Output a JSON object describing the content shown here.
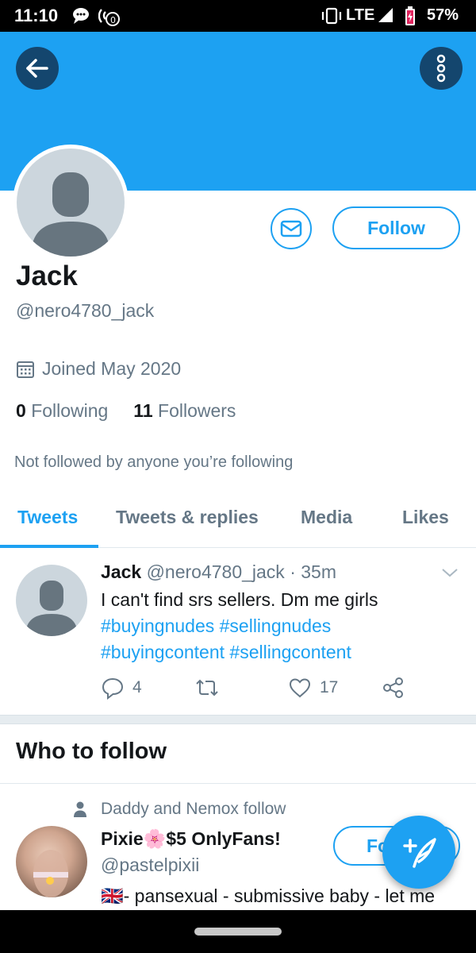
{
  "status_bar": {
    "time": "11:10",
    "network": "LTE",
    "battery": "57%"
  },
  "colors": {
    "accent": "#1da1f2",
    "banner": "#1da1f2",
    "muted_text": "#657786"
  },
  "header": {
    "back_icon": "arrow-left-icon",
    "more_icon": "more-vertical-icon"
  },
  "profile": {
    "name": "Jack",
    "handle": "@nero4780_jack",
    "joined": "Joined May 2020",
    "following_count": "0",
    "following_label": "Following",
    "followers_count": "11",
    "followers_label": "Followers",
    "not_followed": "Not followed by anyone you’re following",
    "follow_label": "Follow",
    "message_icon": "mail-icon"
  },
  "tabs": [
    {
      "label": "Tweets",
      "active": true
    },
    {
      "label": "Tweets & replies",
      "active": false
    },
    {
      "label": "Media",
      "active": false
    },
    {
      "label": "Likes",
      "active": false
    }
  ],
  "tweet": {
    "author": "Jack",
    "handle": "@nero4780_jack",
    "time": "35m",
    "text": "I can't find srs sellers. Dm me girls",
    "hashtags_line1": "#buyingnudes #sellingnudes",
    "hashtags_line2": "#buyingcontent #sellingcontent",
    "replies": "4",
    "retweets": "",
    "likes": "17"
  },
  "who_to_follow": {
    "title": "Who to follow",
    "suggestion": {
      "context": "Daddy and Nemox follow",
      "name": "Pixie🌸$5 OnlyFans!",
      "handle": "@pastelpixii",
      "bio": "🇬🇧- pansexual - submissive baby - let me",
      "follow_label": "Fo"
    }
  },
  "fab": {
    "icon": "compose-tweet-icon"
  }
}
